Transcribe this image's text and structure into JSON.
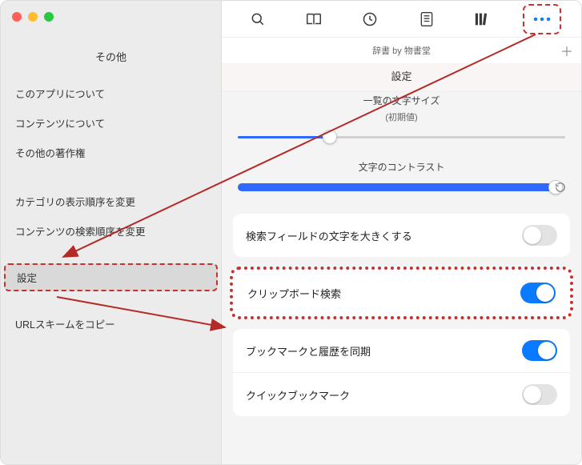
{
  "sidebar": {
    "title": "その他",
    "items": [
      {
        "label": "このアプリについて"
      },
      {
        "label": "コンテンツについて"
      },
      {
        "label": "その他の著作権"
      },
      {
        "label": "カテゴリの表示順序を変更"
      },
      {
        "label": "コンテンツの検索順序を変更"
      },
      {
        "label": "設定",
        "selected": true
      },
      {
        "label": "URLスキームをコピー"
      }
    ]
  },
  "header": {
    "app_title": "辞書 by 物書堂",
    "section_title": "設定"
  },
  "settings": {
    "font_size": {
      "label": "一覧の文字サイズ",
      "sublabel": "(初期値)",
      "value_pct": 28
    },
    "contrast": {
      "label": "文字のコントラスト",
      "value_pct": 95
    },
    "rows": {
      "enlarge_search": {
        "label": "検索フィールドの文字を大きくする",
        "on": false
      },
      "clipboard": {
        "label": "クリップボード検索",
        "on": true
      },
      "sync": {
        "label": "ブックマークと履歴を同期",
        "on": true
      },
      "quick_bm": {
        "label": "クイックブックマーク",
        "on": false
      }
    }
  }
}
